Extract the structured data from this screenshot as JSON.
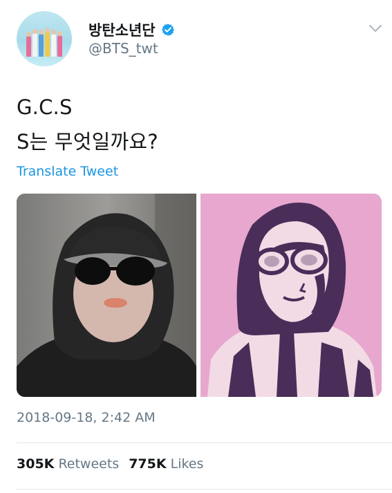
{
  "author": {
    "display_name": "방탄소년단",
    "handle": "@BTS_twt",
    "verified": true
  },
  "tweet": {
    "lines": [
      "G.C.S",
      "S는 무엇일까요?"
    ],
    "translate_label": "Translate Tweet"
  },
  "media": [
    {
      "kind": "photo",
      "subject": "person in black hoodie, cap and round sunglasses"
    },
    {
      "kind": "illustration",
      "subject": "pixel-art drawing of the same person on pink background"
    }
  ],
  "timestamp": "2018-09-18, 2:42 AM",
  "stats": {
    "retweets_count": "305K",
    "retweets_label": "Retweets",
    "likes_count": "775K",
    "likes_label": "Likes"
  },
  "colors": {
    "link": "#1b95e0",
    "secondary_text": "#657786",
    "verified": "#1da1f2",
    "art_background": "#e7a7cf"
  }
}
